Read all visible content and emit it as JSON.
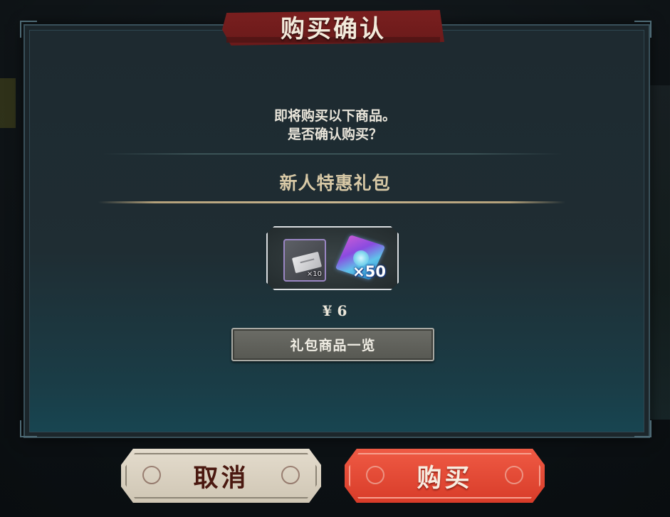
{
  "dialog": {
    "title": "购买确认",
    "prompt_line1": "即将购买以下商品。",
    "prompt_line2": "是否确认购买？",
    "package_name": "新人特惠礼包",
    "items": [
      {
        "icon": "ticket-icon",
        "quantity": "×10"
      },
      {
        "icon": "crystal-icon",
        "quantity": "×50"
      }
    ],
    "price": "¥ 6",
    "contents_button_label": "礼包商品一览"
  },
  "actions": {
    "cancel_label": "取消",
    "buy_label": "购买"
  },
  "colors": {
    "title_banner": "#7a1f1f",
    "buy_button": "#e34c37",
    "cancel_button": "#dcd3c3",
    "package_name_gold": "#d8c9a6"
  }
}
